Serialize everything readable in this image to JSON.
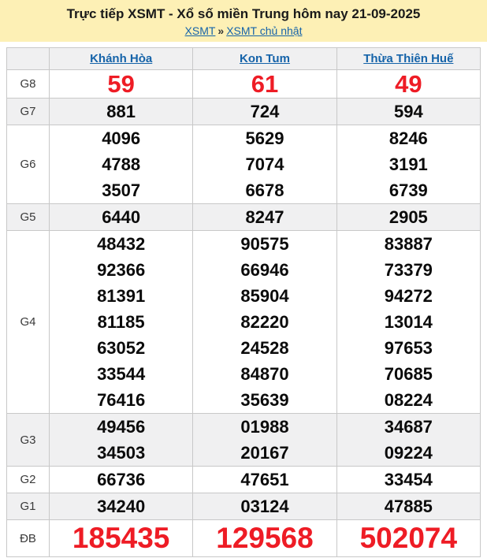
{
  "colors": {
    "banner_yellow": "#fdf0b5",
    "link_blue": "#1563a9",
    "number_red": "#ee1c25",
    "row_stripe": "#f0f0f1",
    "border_gray": "#c8c8c8"
  },
  "header": {
    "title": "Trực tiếp XSMT - Xổ số miền Trung hôm nay 21-09-2025",
    "breadcrumb": {
      "links": [
        "XSMT",
        "XSMT chủ nhật"
      ],
      "separator": "»"
    }
  },
  "table": {
    "corner_label": "",
    "columns": [
      "Khánh Hòa",
      "Kon Tum",
      "Thừa Thiên Huế"
    ],
    "rows": [
      {
        "label": "G8",
        "highlight": true,
        "values": [
          [
            "59"
          ],
          [
            "61"
          ],
          [
            "49"
          ]
        ]
      },
      {
        "label": "G7",
        "highlight": false,
        "values": [
          [
            "881"
          ],
          [
            "724"
          ],
          [
            "594"
          ]
        ]
      },
      {
        "label": "G6",
        "highlight": false,
        "values": [
          [
            "4096",
            "4788",
            "3507"
          ],
          [
            "5629",
            "7074",
            "6678"
          ],
          [
            "8246",
            "3191",
            "6739"
          ]
        ]
      },
      {
        "label": "G5",
        "highlight": false,
        "values": [
          [
            "6440"
          ],
          [
            "8247"
          ],
          [
            "2905"
          ]
        ]
      },
      {
        "label": "G4",
        "highlight": false,
        "values": [
          [
            "48432",
            "92366",
            "81391",
            "81185",
            "63052",
            "33544",
            "76416"
          ],
          [
            "90575",
            "66946",
            "85904",
            "82220",
            "24528",
            "84870",
            "35639"
          ],
          [
            "83887",
            "73379",
            "94272",
            "13014",
            "97653",
            "70685",
            "08224"
          ]
        ]
      },
      {
        "label": "G3",
        "highlight": false,
        "values": [
          [
            "49456",
            "34503"
          ],
          [
            "01988",
            "20167"
          ],
          [
            "34687",
            "09224"
          ]
        ]
      },
      {
        "label": "G2",
        "highlight": false,
        "values": [
          [
            "66736"
          ],
          [
            "47651"
          ],
          [
            "33454"
          ]
        ]
      },
      {
        "label": "G1",
        "highlight": false,
        "values": [
          [
            "34240"
          ],
          [
            "03124"
          ],
          [
            "47885"
          ]
        ]
      },
      {
        "label": "ĐB",
        "highlight": true,
        "values": [
          [
            "185435"
          ],
          [
            "129568"
          ],
          [
            "502074"
          ]
        ]
      }
    ]
  }
}
